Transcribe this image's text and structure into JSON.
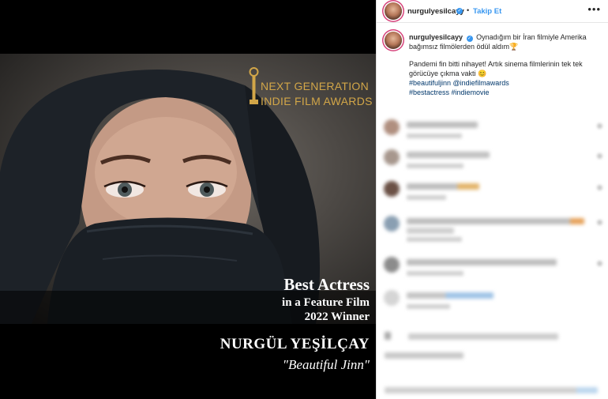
{
  "post_image": {
    "award_line1": "NEXT GENERATION",
    "award_line2": "INDIE FILM AWARDS",
    "caption_best": "Best Actress",
    "caption_feature": "in a Feature Film",
    "caption_year": "2022 Winner",
    "actor_name": "NURGÜL YEŞİLÇAY",
    "film_title": "\"Beautiful Jinn\""
  },
  "header": {
    "username": "nurgulyesilcayy",
    "verified_icon": "✓",
    "separator": "•",
    "follow_label": "Takip Et",
    "more_icon": "•••"
  },
  "caption": {
    "username": "nurgulyesilcayy",
    "verified_icon": "✓",
    "paragraph1": "Oynadığım bir İran filmiyle Amerika bağımsız filmölerden ödül aldım🏆",
    "paragraph2": "Pandemi fin bitti nihayet! Artık sinema filmlerinin tek tek görücüye çıkma vakti 😊",
    "hashtags_line1": "#beautifuljinn @indiefilmawards",
    "hashtags_line2": "#bestactress #indiemovie"
  },
  "colors": {
    "verified_blue": "#3897f0",
    "award_gold": "#d2a648",
    "hashtag_blue": "#00376b"
  }
}
